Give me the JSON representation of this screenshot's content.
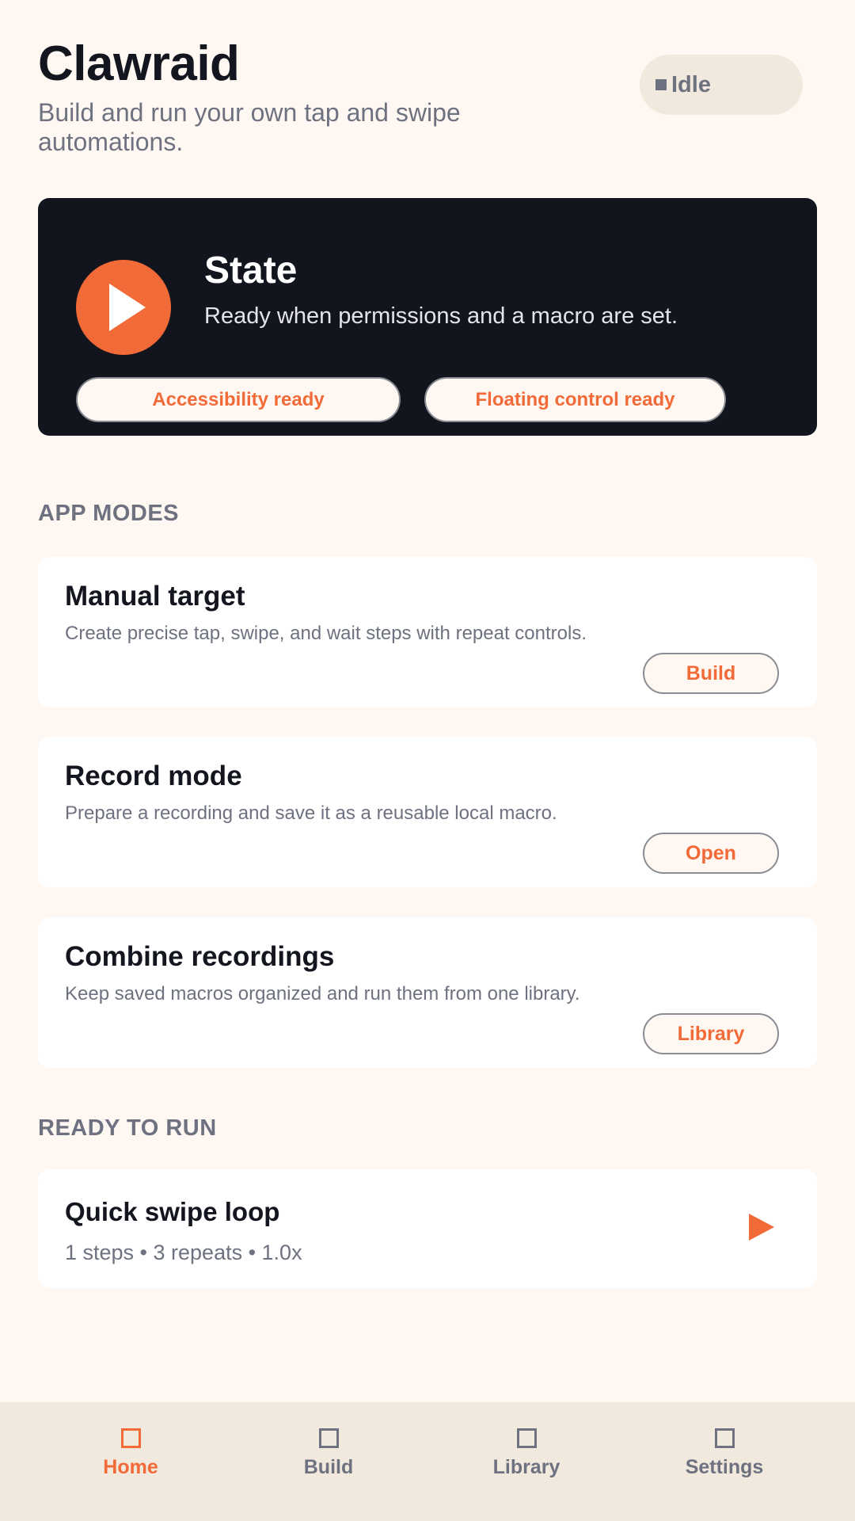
{
  "header": {
    "title": "Clawraid",
    "subtitle": "Build and run your own tap and swipe automations.",
    "status": "Idle"
  },
  "state_card": {
    "title": "State",
    "description": "Ready when permissions and a macro are set.",
    "chips": [
      "Accessibility ready",
      "Floating control ready"
    ]
  },
  "app_modes": {
    "heading": "APP MODES",
    "items": [
      {
        "title": "Manual target",
        "description": "Create precise tap, swipe, and wait steps with repeat controls.",
        "button": "Build"
      },
      {
        "title": "Record mode",
        "description": "Prepare a recording and save it as a reusable local macro.",
        "button": "Open"
      },
      {
        "title": "Combine recordings",
        "description": "Keep saved macros organized and run them from one library.",
        "button": "Library"
      }
    ]
  },
  "ready_to_run": {
    "heading": "READY TO RUN",
    "macro": {
      "title": "Quick swipe loop",
      "meta": "1 steps • 3 repeats • 1.0x"
    }
  },
  "bottom_nav": {
    "items": [
      "Home",
      "Build",
      "Library",
      "Settings"
    ],
    "active": "Home"
  },
  "colors": {
    "accent": "#F26A38",
    "background": "#FFF8F2",
    "dark_card": "#13151E",
    "muted_text": "#6E7280",
    "nav_background": "#F1E8DE"
  },
  "icons": {
    "state": "play-icon",
    "status": "stop-square-icon",
    "ready_run": "play-icon",
    "nav": "square-icon"
  }
}
